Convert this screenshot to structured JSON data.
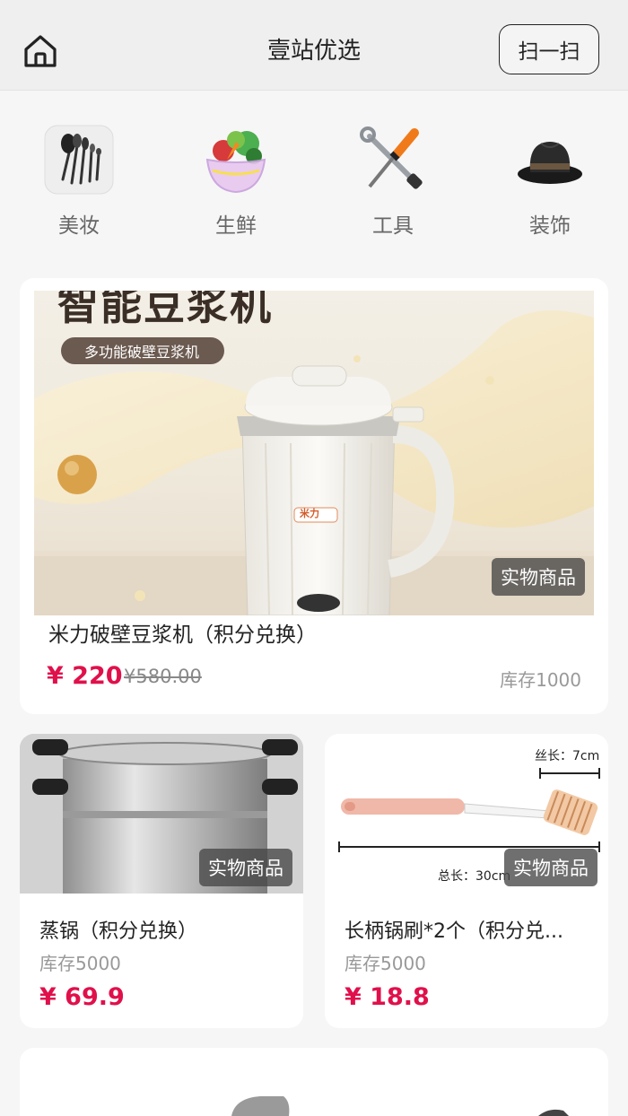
{
  "header": {
    "title": "壹站优选",
    "scan_label": "扫一扫"
  },
  "categories": [
    {
      "label": "美妆",
      "icon": "makeup-brushes-icon"
    },
    {
      "label": "生鲜",
      "icon": "vegetable-bowl-icon"
    },
    {
      "label": "工具",
      "icon": "tools-icon"
    },
    {
      "label": "装饰",
      "icon": "hat-icon"
    }
  ],
  "featured": {
    "image_text": "智能豆浆机",
    "image_subtext": "多功能破壁豆浆机",
    "brand_mark": "米力",
    "badge": "实物商品",
    "name": "米力破壁豆浆机（积分兑换）",
    "price": "¥ 220",
    "original_price": "¥580.00",
    "stock": "库存1000"
  },
  "products": [
    {
      "badge": "实物商品",
      "name": "蒸锅（积分兑换）",
      "stock": "库存5000",
      "price": "¥ 69.9"
    },
    {
      "badge": "实物商品",
      "name": "长柄锅刷*2个（积分兑...",
      "stock": "库存5000",
      "price": "¥ 18.8",
      "dim_head": "丝长：7cm",
      "dim_total": "总长：30cm"
    }
  ],
  "colors": {
    "price": "#e0104b",
    "header_bg": "#efefef",
    "page_bg": "#f6f6f6"
  }
}
